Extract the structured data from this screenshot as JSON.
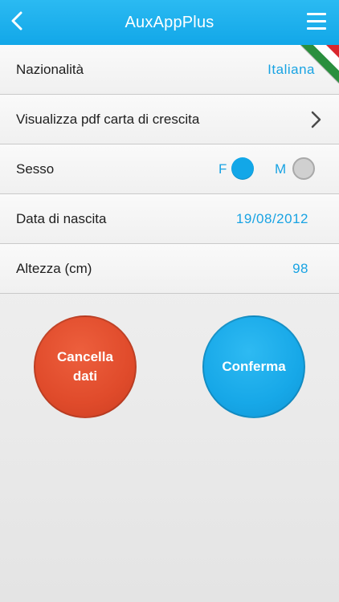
{
  "header": {
    "title": "AuxAppPlus",
    "back_icon": "chevron-left-icon",
    "menu_icon": "hamburger-menu-icon"
  },
  "form": {
    "nationality": {
      "label": "Nazionalità",
      "value": "Italiana",
      "flag_icon": "italian-flag-icon"
    },
    "growth_chart": {
      "label": "Visualizza pdf carta di crescita",
      "icon": "chevron-right-icon"
    },
    "sex": {
      "label": "Sesso",
      "option_f": "F",
      "option_m": "M",
      "selected": "F"
    },
    "birth_date": {
      "label": "Data di nascita",
      "value": "19/08/2012"
    },
    "height": {
      "label": "Altezza (cm)",
      "value": "98"
    }
  },
  "actions": {
    "cancel_label": "Cancella dati",
    "confirm_label": "Conferma"
  },
  "colors": {
    "accent": "#12a7e8",
    "cancel": "#e04b2b",
    "text": "#1e1e1e"
  }
}
